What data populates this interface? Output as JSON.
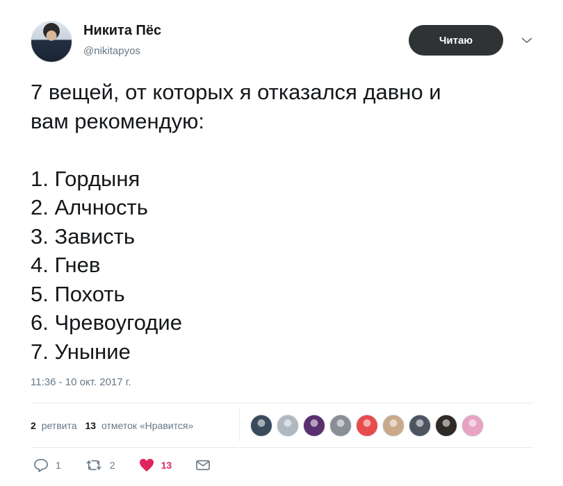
{
  "user": {
    "display_name": "Никита Пёс",
    "handle": "@nikitapyos",
    "follow_label": "Читаю"
  },
  "tweet": {
    "text": "7 вещей, от которых я отказался давно и\nвам рекомендую:\n\n1. Гордыня\n2. Алчность\n3. Зависть\n4. Гнев\n5. Похоть\n6. Чревоугодие\n7. Уныние",
    "timestamp": "11:36 - 10 окт. 2017 г."
  },
  "stats": {
    "retweets_count": "2",
    "retweets_label": "ретвита",
    "likes_count": "13",
    "likes_label": "отметок «Нравится»"
  },
  "likers": [
    {
      "icon": "avatar",
      "color": "#3a4a5c"
    },
    {
      "icon": "avatar",
      "color": "#b0b8c0"
    },
    {
      "icon": "avatar",
      "color": "#5a2f6e"
    },
    {
      "icon": "avatar",
      "color": "#8a8f96"
    },
    {
      "icon": "avatar",
      "color": "#e84b4b"
    },
    {
      "icon": "avatar",
      "color": "#c9a98a"
    },
    {
      "icon": "avatar",
      "color": "#4d5560"
    },
    {
      "icon": "avatar",
      "color": "#2e2a26"
    },
    {
      "icon": "avatar",
      "color": "#e7a3c1"
    }
  ],
  "actions": {
    "reply_count": "1",
    "retweet_count": "2",
    "like_count": "13"
  },
  "colors": {
    "like_accent": "#e0245e",
    "secondary_text": "#657786",
    "follow_button_bg": "#2f3336"
  }
}
